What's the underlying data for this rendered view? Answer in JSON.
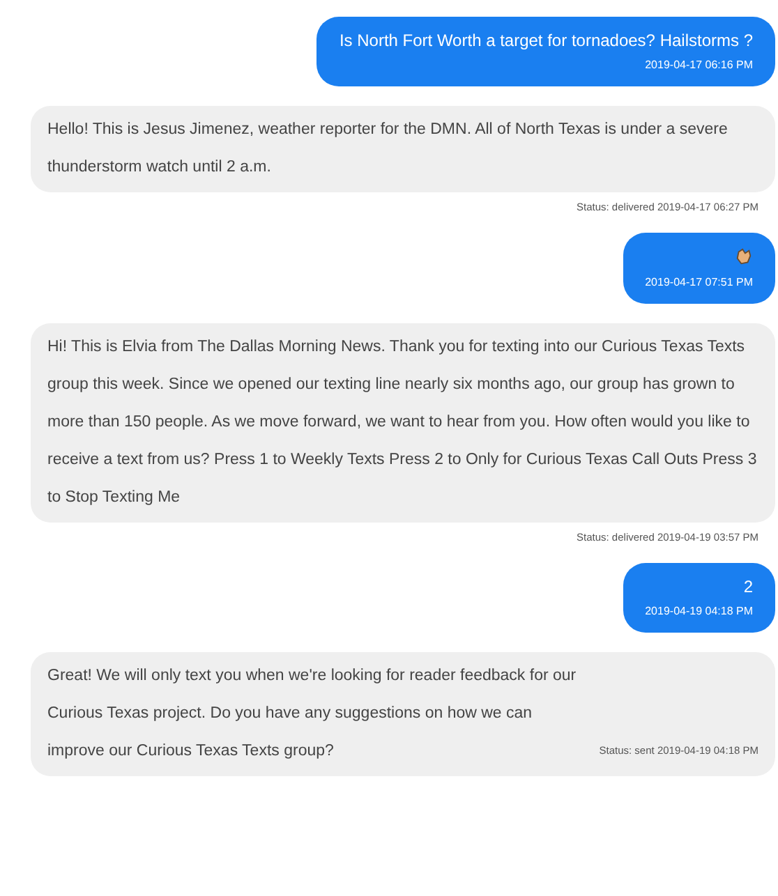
{
  "messages": [
    {
      "kind": "outgoing",
      "text": "Is North Fort Worth a target for tornadoes? Hailstorms ?",
      "time": "2019-04-17 06:16 PM"
    },
    {
      "kind": "incoming",
      "text": "Hello! This is Jesus Jimenez, weather reporter for the DMN. All of North Texas is under a severe thunderstorm watch until 2 a.m.",
      "status": "Status: delivered 2019-04-17 06:27 PM"
    },
    {
      "kind": "emoji",
      "time": "2019-04-17 07:51 PM"
    },
    {
      "kind": "incoming",
      "text": "Hi! This is Elvia from The Dallas Morning News. Thank you for texting into our Curious Texas Texts group this week. Since we opened our texting line nearly six months ago, our group has grown to more than 150 people. As we move forward, we want to hear from you. How often would you like to receive a text from us? Press 1 to Weekly Texts Press 2 to Only for Curious Texas Call Outs Press 3 to Stop Texting Me",
      "status": "Status: delivered 2019-04-19 03:57 PM"
    },
    {
      "kind": "outgoing",
      "text": "2",
      "time": "2019-04-19 04:18 PM"
    },
    {
      "kind": "incoming_inline",
      "text": "Great! We will only text you when we're looking for reader feedback for our Curious Texas project. Do you have any suggestions on how we can improve our Curious Texas Texts group?",
      "status": "Status: sent 2019-04-19 04:18 PM"
    }
  ]
}
